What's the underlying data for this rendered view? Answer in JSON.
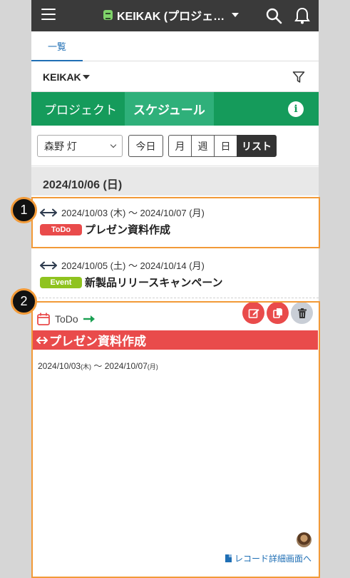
{
  "header": {
    "app_title": "KEIKAK (プロジェ…",
    "colors": {
      "topbar": "#3a3a3a",
      "accent_green": "#159b5b",
      "todo_red": "#e94b4b",
      "event_green": "#8fc31f",
      "highlight_orange": "#f29a38"
    }
  },
  "view_tabs": [
    {
      "label": "一覧"
    }
  ],
  "app_selector": {
    "label": "KEIKAK"
  },
  "nav": {
    "tabs": [
      {
        "label": "プロジェクト",
        "active": false
      },
      {
        "label": "スケジュール",
        "active": true
      }
    ]
  },
  "filters": {
    "user": "森野 灯",
    "today": "今日",
    "views": [
      {
        "label": "月"
      },
      {
        "label": "週"
      },
      {
        "label": "日"
      },
      {
        "label": "リスト",
        "selected": true
      }
    ]
  },
  "list": {
    "date_header": "2024/10/06 (日)",
    "items": [
      {
        "date_range": "2024/10/03 (木) ～ 2024/10/07 (月)",
        "badge": "ToDo",
        "title": "プレゼン資料作成"
      },
      {
        "date_range": "2024/10/05 (土) ～ 2024/10/14 (月)",
        "badge": "Event",
        "title": "新製品リリースキャンペーン"
      }
    ]
  },
  "detail": {
    "type": "ToDo",
    "title": "プレゼン資料作成",
    "start": "2024/10/03",
    "start_dow": "(木)",
    "sep": " ～ ",
    "end": "2024/10/07",
    "end_dow": "(月)",
    "link": "レコード詳細画面へ"
  },
  "annotations": {
    "marker1": "1",
    "marker2": "2"
  }
}
